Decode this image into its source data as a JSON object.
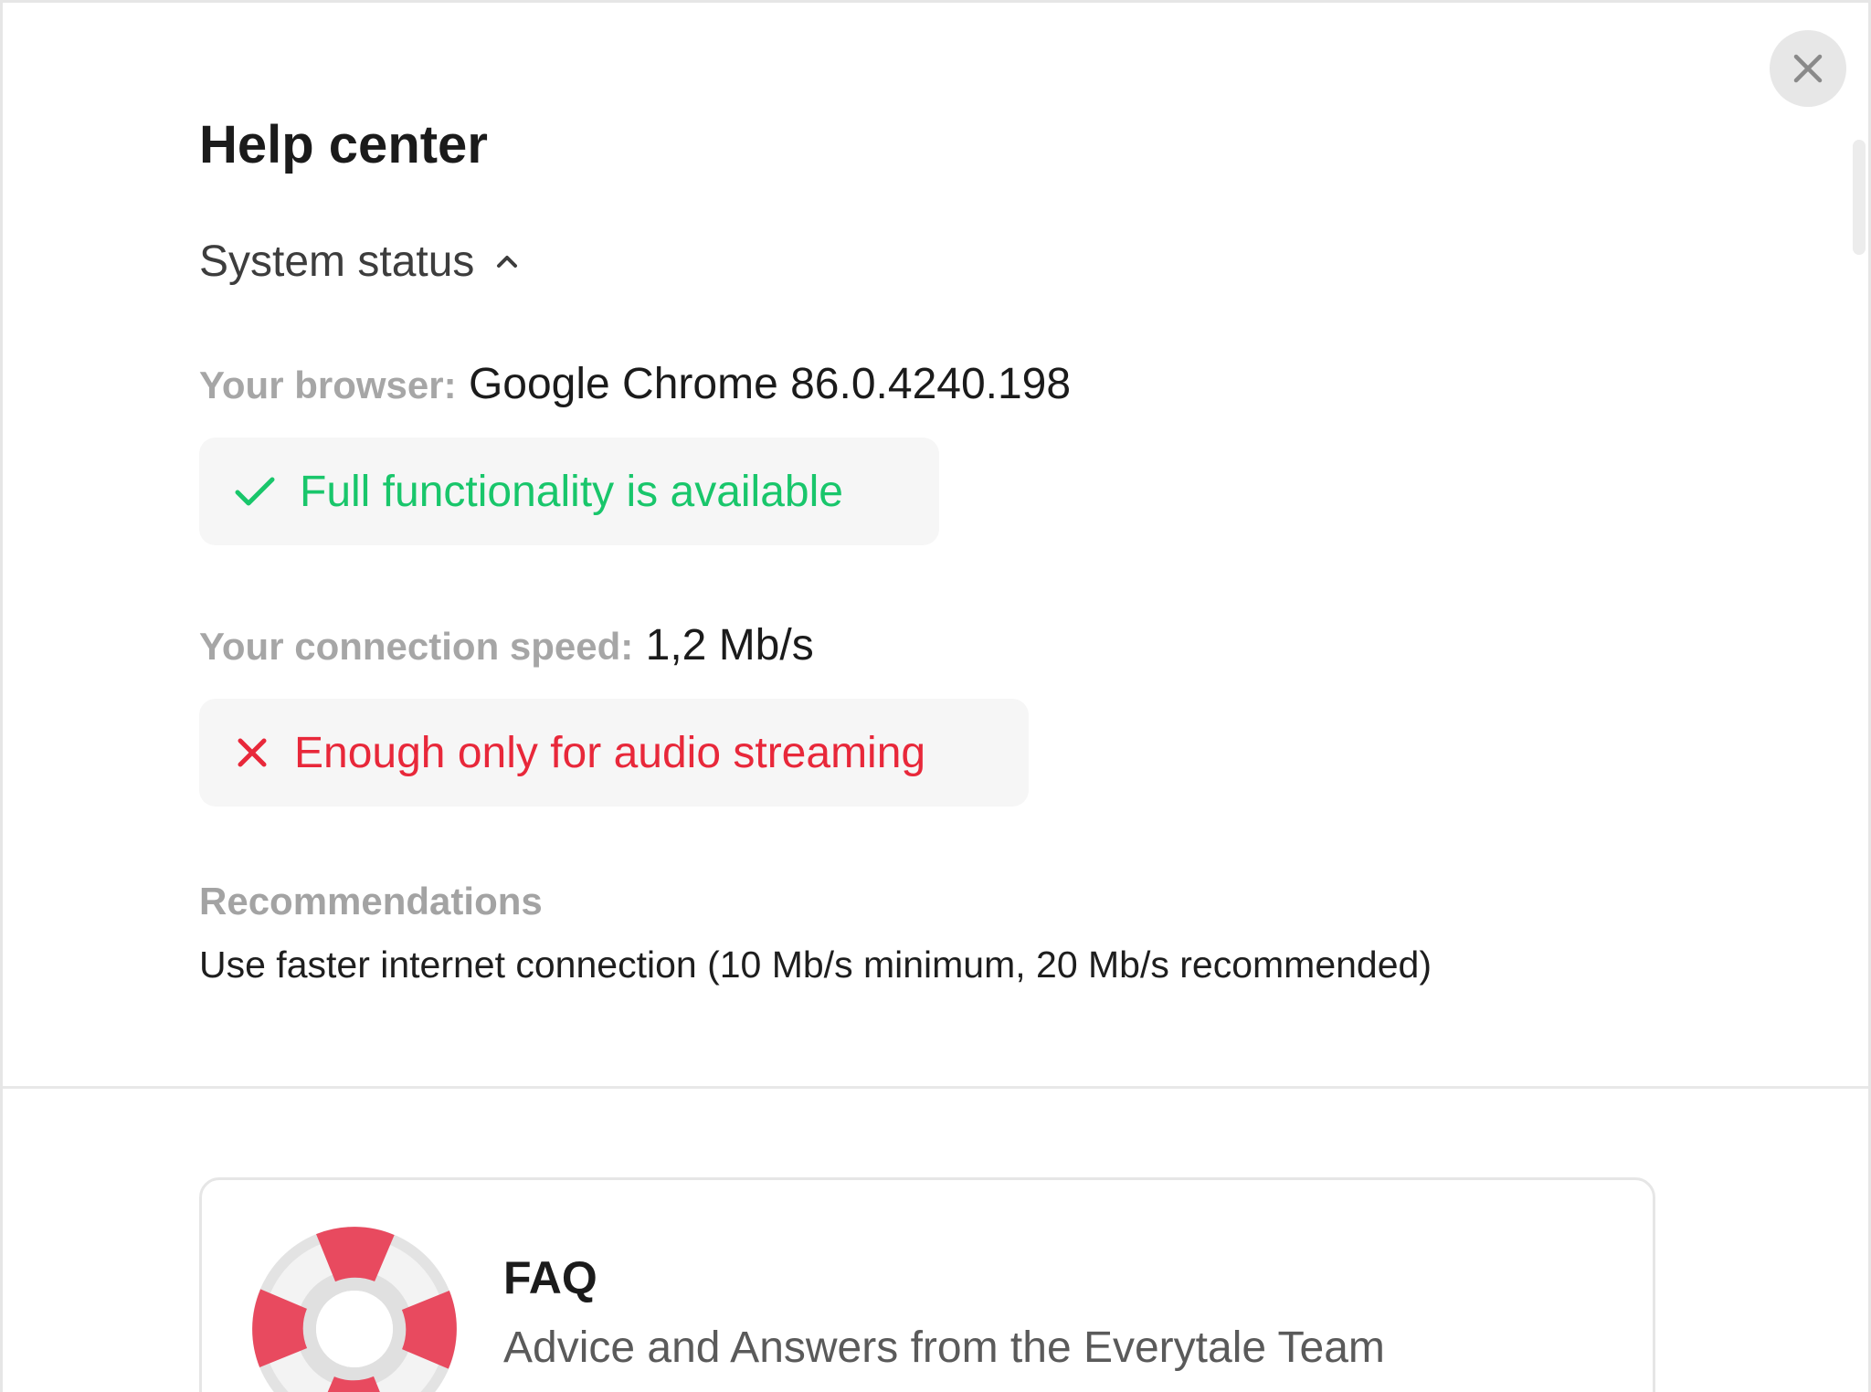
{
  "title": "Help center",
  "system_status": {
    "label": "System status",
    "expanded": true
  },
  "browser": {
    "key": "Your browser:",
    "value": "Google Chrome 86.0.4240.198",
    "status_text": "Full functionality is available",
    "status_icon": "check-icon",
    "status_color": "#19c66b"
  },
  "connection": {
    "key": "Your connection speed:",
    "value": "1,2 Mb/s",
    "status_text": "Enough only for audio streaming",
    "status_icon": "cross-icon",
    "status_color": "#e8283a"
  },
  "recommendations": {
    "title": "Recommendations",
    "text": "Use faster internet connection (10 Mb/s minimum, 20 Mb/s recommended)"
  },
  "faq": {
    "title": "FAQ",
    "subtitle": "Advice and Answers from the Everytale Team",
    "icon": "lifebuoy-icon"
  }
}
